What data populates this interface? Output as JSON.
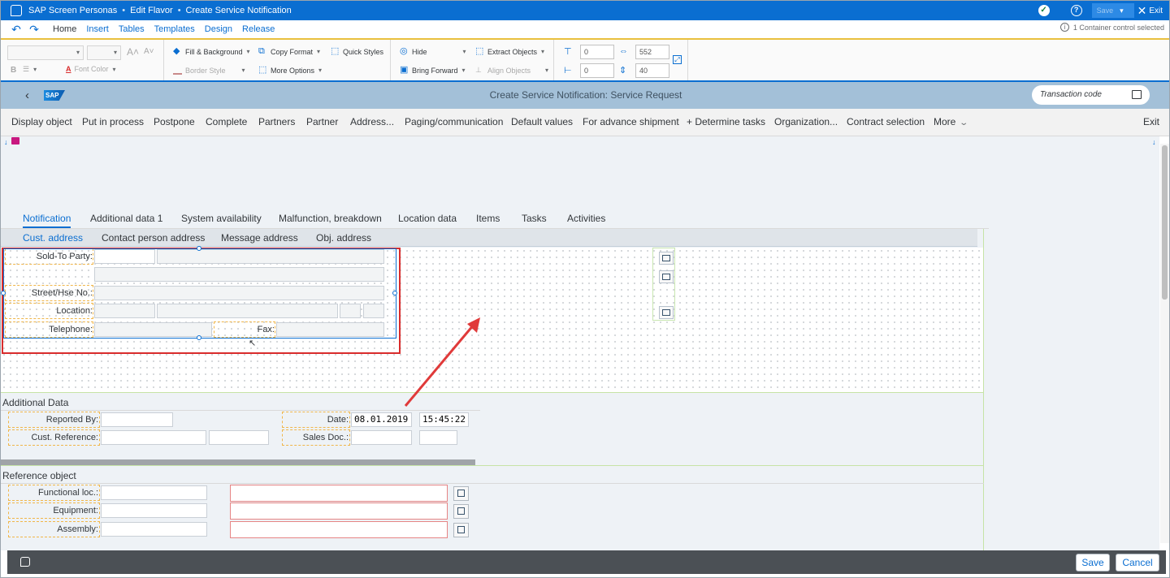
{
  "titlebar": {
    "app": "SAP Screen Personas",
    "separator": "•",
    "mode": "Edit Flavor",
    "screen": "Create Service Notification",
    "save": "Save",
    "exit": "Exit"
  },
  "ribbon": {
    "tabs": [
      "Home",
      "Insert",
      "Tables",
      "Templates",
      "Design",
      "Release"
    ],
    "status": "1 Container control selected",
    "font_color": "Font Color",
    "fill_bg": "Fill & Background",
    "border_style": "Border Style",
    "copy_format": "Copy Format",
    "more_options": "More Options",
    "quick_styles": "Quick Styles",
    "hide": "Hide",
    "bring_forward": "Bring Forward",
    "extract_objects": "Extract Objects",
    "align_objects": "Align Objects",
    "top": "0",
    "left": "0",
    "width": "552",
    "height": "40"
  },
  "shell": {
    "logo": "SAP",
    "title": "Create Service Notification: Service Request",
    "tcode_placeholder": "Transaction code"
  },
  "toolbar": {
    "items": [
      "Display object",
      "Put in process",
      "Postpone",
      "Complete",
      "Partners",
      "Partner",
      "Address...",
      "Paging/communication",
      "Default values",
      "For advance shipment",
      "+ Determine tasks",
      "Organization...",
      "Contract selection"
    ],
    "more": "More",
    "exit": "Exit"
  },
  "canvas": {
    "tabs": [
      "Notification",
      "Additional data 1",
      "System availability",
      "Malfunction, breakdown",
      "Location data",
      "Items",
      "Tasks",
      "Activities"
    ],
    "subtabs": [
      "Cust. address",
      "Contact person address",
      "Message address",
      "Obj. address"
    ]
  },
  "address": {
    "sold_to": "Sold-To Party:",
    "street": "Street/Hse No.:",
    "location": "Location:",
    "telephone": "Telephone:",
    "fax": "Fax:"
  },
  "additional": {
    "title": "Additional Data",
    "reported_by": "Reported By:",
    "cust_ref": "Cust. Reference:",
    "date_label": "Date:",
    "date": "08.01.2019",
    "time": "15:45:22",
    "sales_doc": "Sales Doc.:"
  },
  "reference": {
    "title": "Reference object",
    "functional_loc": "Functional loc.:",
    "equipment": "Equipment:",
    "assembly": "Assembly:"
  },
  "footer": {
    "save": "Save",
    "cancel": "Cancel"
  },
  "colors": {
    "shell_blue": "#0a6ed1",
    "header_bg": "#a3c0d8",
    "highlight_red": "#d92c2c",
    "selection_blue": "#0a6ed1",
    "field_border_orange": "#f0b64a"
  }
}
